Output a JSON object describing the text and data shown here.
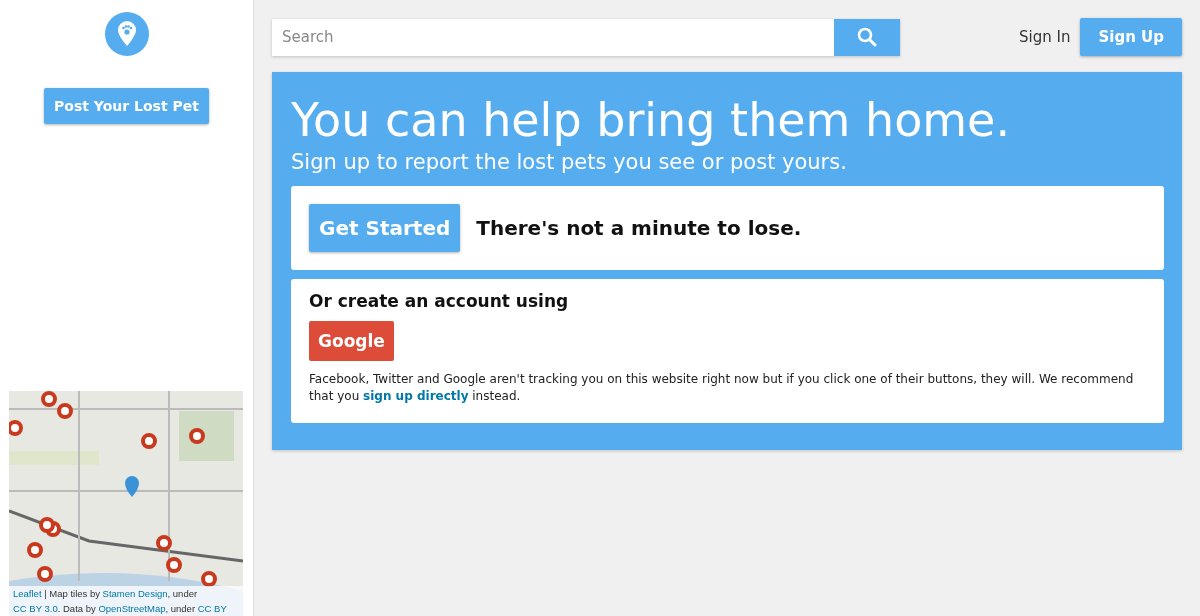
{
  "sidebar": {
    "post_button": "Post Your Lost Pet",
    "map": {
      "kind": "picture",
      "attribution": [
        {
          "kind": "link",
          "text": "Leaflet"
        },
        {
          "kind": "text",
          "text": " | Map tiles by "
        },
        {
          "kind": "link",
          "text": "Stamen Design"
        },
        {
          "kind": "text",
          "text": ", under "
        },
        {
          "kind": "link",
          "text": "CC BY 3.0"
        },
        {
          "kind": "text",
          "text": ". Data by "
        },
        {
          "kind": "link",
          "text": "OpenStreetMap"
        },
        {
          "kind": "text",
          "text": ", under "
        },
        {
          "kind": "link",
          "text": "CC BY"
        }
      ]
    }
  },
  "header": {
    "search": {
      "placeholder": "Search"
    },
    "sign_in": "Sign In",
    "sign_up": "Sign Up"
  },
  "hero": {
    "title": "You can help bring them home.",
    "subtitle": "Sign up to report the lost pets you see or post yours.",
    "cta": {
      "button": "Get Started",
      "tagline": "There's not a minute to lose."
    },
    "social": {
      "heading": "Or create an account using",
      "button": "Google",
      "note": [
        {
          "kind": "text",
          "text": "Facebook, Twitter and Google aren't tracking you on this website right now but if you click one of their buttons, they will. We recommend that you "
        },
        {
          "kind": "link",
          "text": "sign up directly"
        },
        {
          "kind": "text",
          "text": " instead."
        }
      ]
    }
  }
}
